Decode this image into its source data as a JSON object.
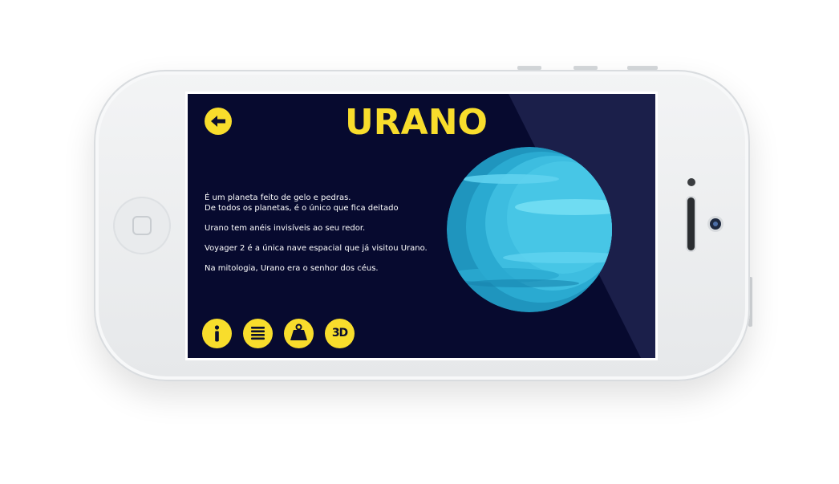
{
  "app": {
    "title": "URANO"
  },
  "navigation": {
    "back_icon": "arrow-left-icon"
  },
  "content": {
    "paragraphs": [
      {
        "lines": [
          "É um planeta feito de gelo e pedras.",
          "De todos os planetas, é o único que fica deitado"
        ]
      },
      {
        "lines": [
          "Urano tem anéis invisíveis ao seu redor."
        ]
      },
      {
        "lines": [
          "Voyager 2 é a única nave espacial que já visitou Urano."
        ]
      },
      {
        "lines": [
          "Na mitologia, Urano era o senhor dos céus."
        ]
      }
    ]
  },
  "toolbar": {
    "info_icon": "info-icon",
    "list_icon": "list-icon",
    "weight_icon": "weight-icon",
    "three_d_label": "3D"
  },
  "colors": {
    "screen_background": "#070a2f",
    "accent_yellow": "#f8dd2c",
    "planet_main": "#3dbde0",
    "planet_dark": "#1f95be",
    "planet_light": "#6fdcf2",
    "text": "#ffffff"
  }
}
